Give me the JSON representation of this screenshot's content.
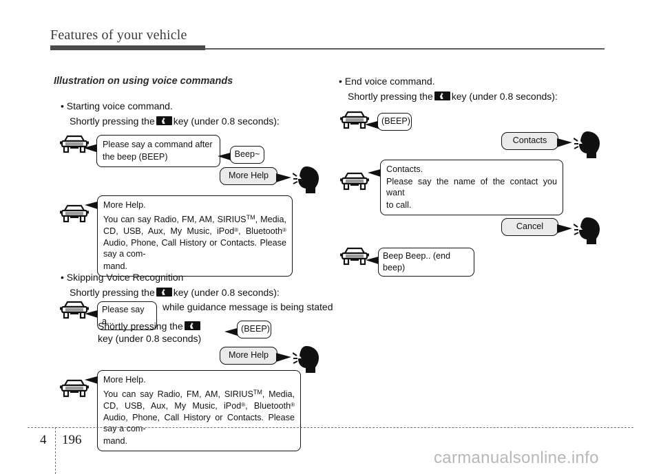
{
  "header": {
    "chapter_title": "Features of your vehicle"
  },
  "footer": {
    "chapter_number": "4",
    "page_number": "196",
    "watermark": "carmanualsonline.info"
  },
  "section": {
    "heading": "Illustration on using voice commands"
  },
  "left_column": {
    "start": {
      "bullet": "• Starting voice command.",
      "instruction_before": "Shortly pressing the",
      "instruction_after": "key (under 0.8 seconds):",
      "car_bubble": {
        "line1": "Please say a command after",
        "line2": "the beep (BEEP)"
      },
      "beep_bubble": "Beep~",
      "user_bubble": "More Help"
    },
    "more_help": {
      "title": "More Help.",
      "body_part1": "You can say Radio, FM, AM, SIRIUS",
      "body_tm": "TM",
      "body_part2": ", Media, CD, USB, Aux, My Music, iPod",
      "body_reg1": "®",
      "body_part3": ", Bluetooth",
      "body_reg2": "®",
      "body_part4": " Audio, Phone, Call History or Contacts. Please say a com-",
      "body_part5": "mand."
    },
    "skipping": {
      "bullet": "• Skipping Voice Recognition",
      "instruction_before": "Shortly pressing the",
      "instruction_after": "key (under 0.8 seconds):",
      "say_bubble": "Please say a...",
      "trailing_text": "while guidance message is being stated",
      "second_instruction_before": "Shortly pressing the",
      "second_instruction_line2": "key (under 0.8 seconds)",
      "beep_bubble": "(BEEP)",
      "user_bubble": "More Help"
    },
    "more_help_2": {
      "title": "More Help.",
      "body_part1": "You can say Radio, FM, AM, SIRIUS",
      "body_tm": "TM",
      "body_part2": ", Media, CD, USB, Aux, My Music, iPod",
      "body_reg1": "®",
      "body_part3": ", Bluetooth",
      "body_reg2": "®",
      "body_part4": " Audio, Phone, Call History or Contacts. Please say a com-",
      "body_part5": "mand."
    }
  },
  "right_column": {
    "end": {
      "bullet": "• End voice command.",
      "instruction_before": "Shortly pressing the",
      "instruction_after": "key (under 0.8 seconds):",
      "beep_bubble": "(BEEP)",
      "user_bubble": "Contacts"
    },
    "contacts": {
      "title": "Contacts.",
      "body_line1": "Please say the name of the contact you want",
      "body_line2": "to call."
    },
    "cancel": {
      "user_bubble": "Cancel",
      "car_bubble": "Beep Beep.. (end beep)"
    }
  },
  "icons": {
    "car": "car-front-icon",
    "head": "speaking-head-icon",
    "key": "voice-recognition-key-icon"
  }
}
